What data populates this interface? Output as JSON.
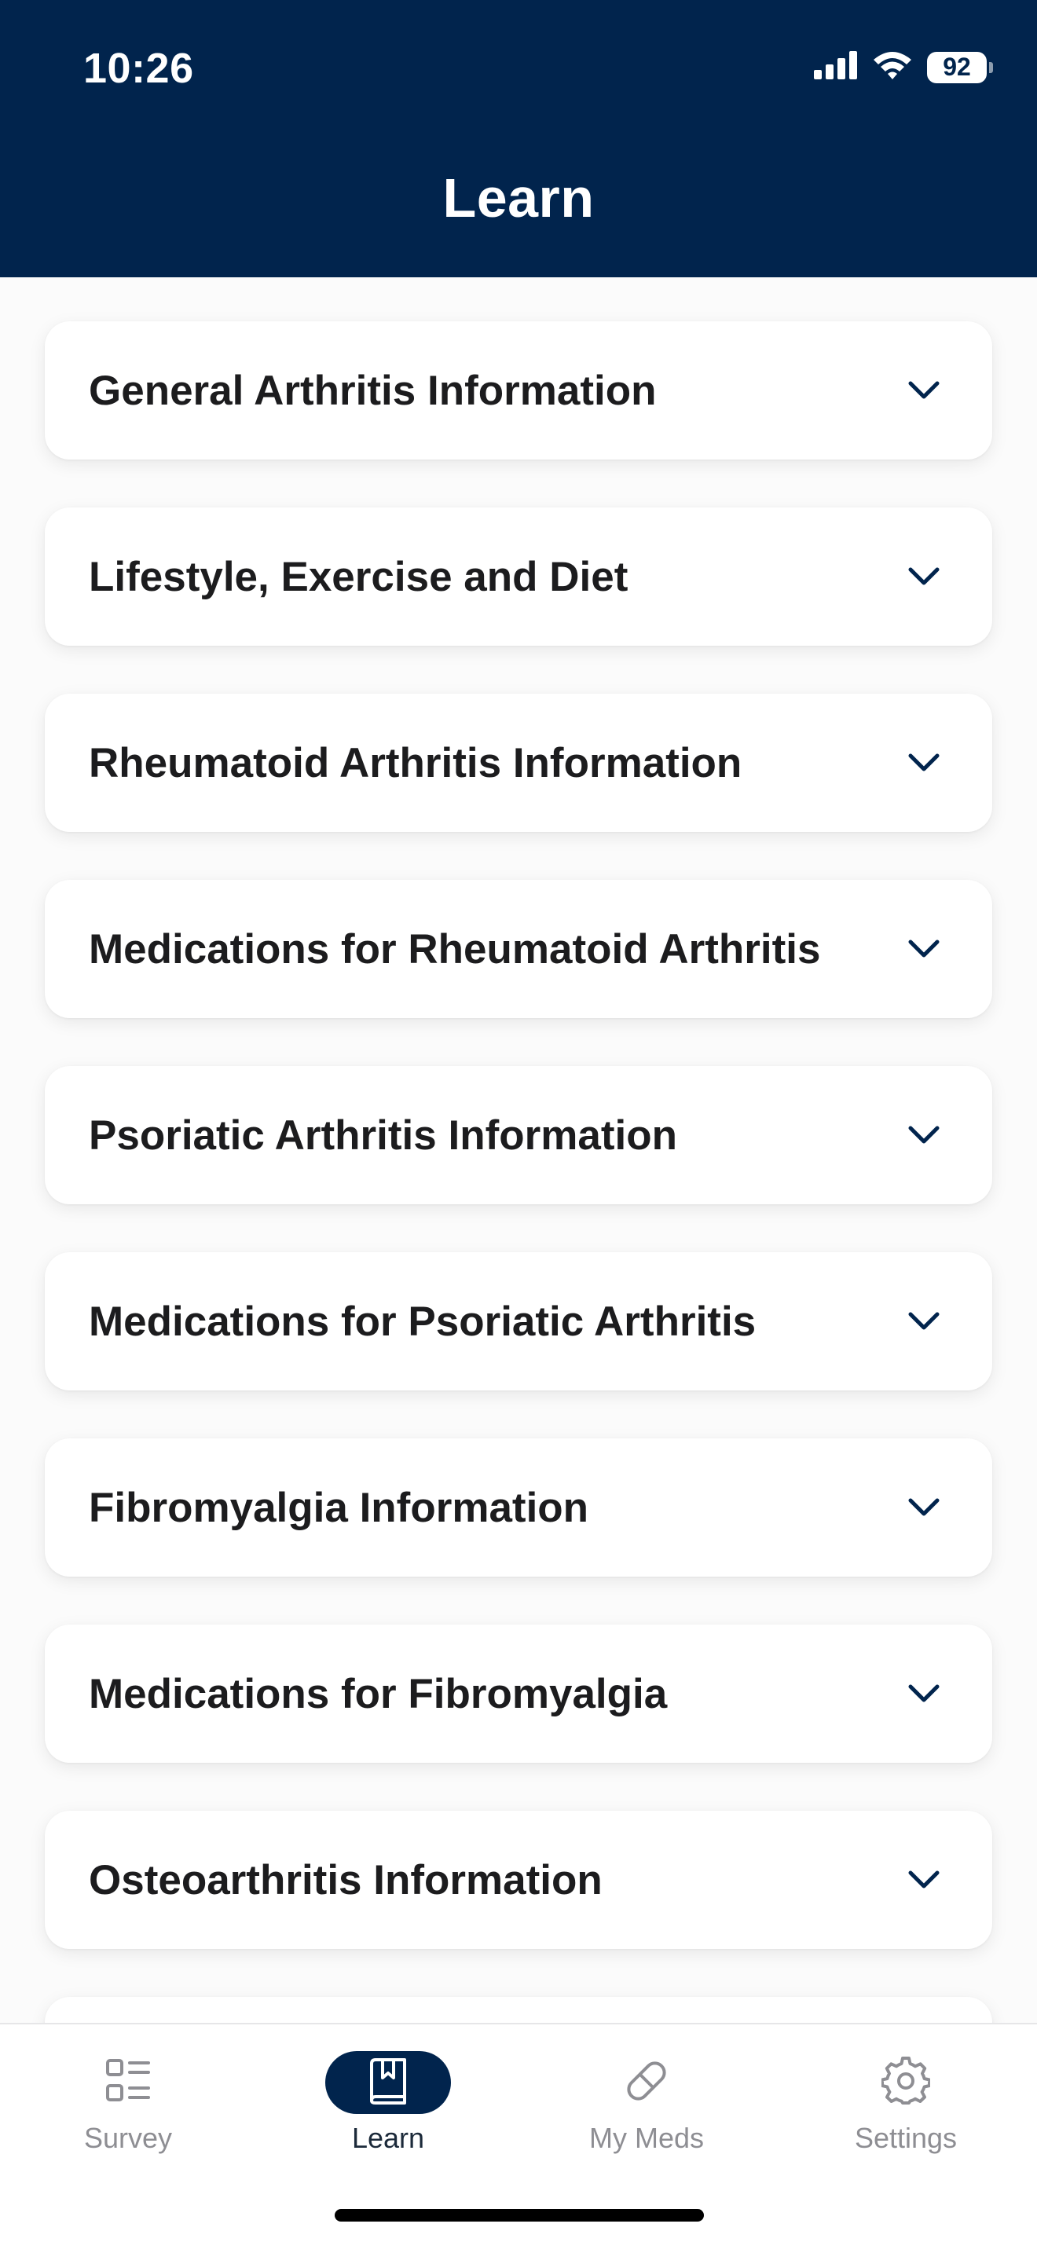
{
  "status_bar": {
    "time": "10:26",
    "battery": "92",
    "icons": [
      "signal-icon",
      "wifi-icon",
      "battery-icon"
    ]
  },
  "header": {
    "title": "Learn"
  },
  "topics": [
    {
      "label": "General Arthritis Information",
      "icon": "chevron-down-icon"
    },
    {
      "label": "Lifestyle, Exercise and Diet",
      "icon": "chevron-down-icon"
    },
    {
      "label": "Rheumatoid Arthritis Information",
      "icon": "chevron-down-icon"
    },
    {
      "label": "Medications for Rheumatoid Arthritis",
      "icon": "chevron-down-icon"
    },
    {
      "label": "Psoriatic Arthritis Information",
      "icon": "chevron-down-icon"
    },
    {
      "label": "Medications for Psoriatic Arthritis",
      "icon": "chevron-down-icon"
    },
    {
      "label": "Fibromyalgia Information",
      "icon": "chevron-down-icon"
    },
    {
      "label": "Medications for Fibromyalgia",
      "icon": "chevron-down-icon"
    },
    {
      "label": "Osteoarthritis Information",
      "icon": "chevron-down-icon"
    }
  ],
  "tabbar": {
    "tabs": [
      {
        "label": "Survey",
        "icon": "survey-list-icon",
        "active": false
      },
      {
        "label": "Learn",
        "icon": "book-icon",
        "active": true
      },
      {
        "label": "My Meds",
        "icon": "pill-icon",
        "active": false
      },
      {
        "label": "Settings",
        "icon": "gear-icon",
        "active": false
      }
    ]
  },
  "colors": {
    "header_bg": "#01244d",
    "accent": "#01244d",
    "card_bg": "#ffffff",
    "text": "#1c1c1e",
    "tab_inactive": "#8e8e93"
  }
}
